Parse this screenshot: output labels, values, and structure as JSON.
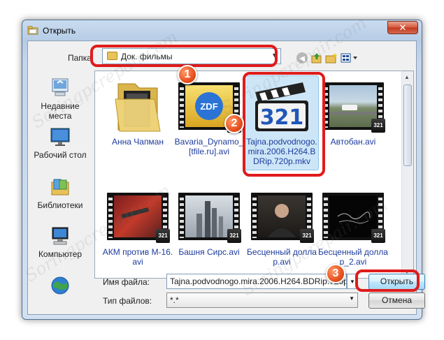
{
  "window": {
    "title": "Открыть",
    "close_glyph": "✕"
  },
  "toolbar": {
    "lookin_label": "Папка",
    "lookin_value": "Док. фильмы",
    "back_icon": "back-arrow-icon",
    "up_icon": "up-folder-icon",
    "newfolder_icon": "new-folder-icon",
    "views_icon": "views-menu-icon"
  },
  "places": [
    {
      "label": "Недавние места",
      "icon": "recent-places-icon"
    },
    {
      "label": "Рабочий стол",
      "icon": "desktop-icon"
    },
    {
      "label": "Библиотеки",
      "icon": "libraries-icon"
    },
    {
      "label": "Компьютер",
      "icon": "computer-icon"
    },
    {
      "label": "",
      "icon": "network-icon"
    }
  ],
  "files": [
    {
      "label": "Анна Чапман",
      "kind": "folder"
    },
    {
      "label": "Bavaria_Dynamo_[tfile.ru].avi",
      "kind": "video",
      "overlay_text": "ZDF"
    },
    {
      "label": "Tajna.podvodnogo.mira.2006.H264.BDRip.720p.mkv",
      "kind": "player-icon",
      "overlay_text": "321"
    },
    {
      "label": "Автобан.avi",
      "kind": "video"
    },
    {
      "label": "АКМ против М-16.avi",
      "kind": "video"
    },
    {
      "label": "Башня Сирс.avi",
      "kind": "video"
    },
    {
      "label": "Бесценный доллар.avi",
      "kind": "video"
    },
    {
      "label": "Бесценный доллар_2.avi",
      "kind": "video"
    }
  ],
  "badge_text": "321",
  "filename": {
    "label": "Имя файла:",
    "value": "Tajna.podvodnogo.mira.2006.H264.BDRip.720p"
  },
  "filetype": {
    "label": "Тип файлов:",
    "value": "*.*"
  },
  "buttons": {
    "open": "Открыть",
    "cancel": "Отмена"
  },
  "steps": [
    "1",
    "2",
    "3"
  ],
  "watermark": "Soringpcrepair.com",
  "colors": {
    "highlight": "#e01b1b",
    "selection": "#cde6f7",
    "link_text": "#1d3b9c"
  }
}
